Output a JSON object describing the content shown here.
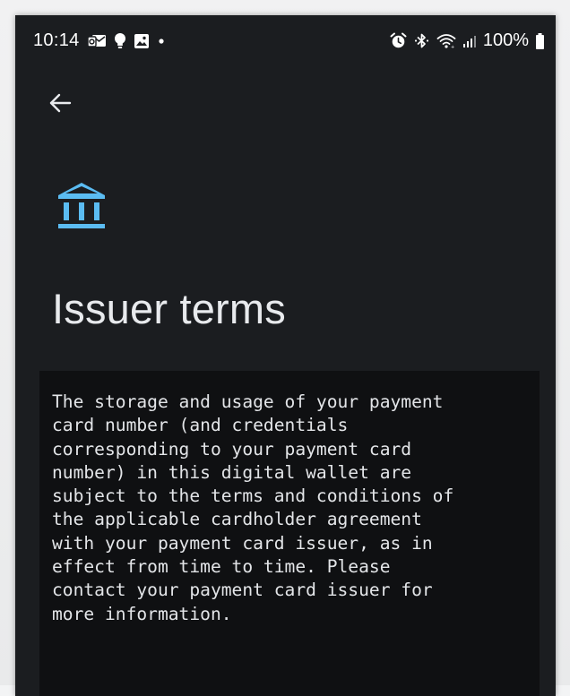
{
  "status_bar": {
    "time": "10:14",
    "battery_percent": "100%",
    "icons_left": [
      "outlook-notification-icon",
      "lightbulb-icon",
      "gallery-icon",
      "dot-icon"
    ],
    "icons_right": [
      "alarm-icon",
      "bluetooth-icon",
      "wifi-icon",
      "signal-icon",
      "battery-icon"
    ]
  },
  "navigation": {
    "back_icon": "back-arrow-icon"
  },
  "header": {
    "icon": "bank-icon",
    "icon_color": "#5bbcf2",
    "title": "Issuer terms"
  },
  "terms": {
    "lines": [
      "The storage and usage of your payment",
      "card number (and credentials",
      "corresponding to your payment card",
      "number) in this digital wallet are",
      "subject to the terms and conditions of",
      "the applicable cardholder agreement",
      "with your payment card issuer, as in",
      "effect from time to time. Please",
      "contact your payment card issuer for",
      "more information."
    ]
  },
  "colors": {
    "background": "#1b1d20",
    "terms_background": "#0f1012",
    "text": "#e3e5e8",
    "accent": "#5bbcf2"
  }
}
